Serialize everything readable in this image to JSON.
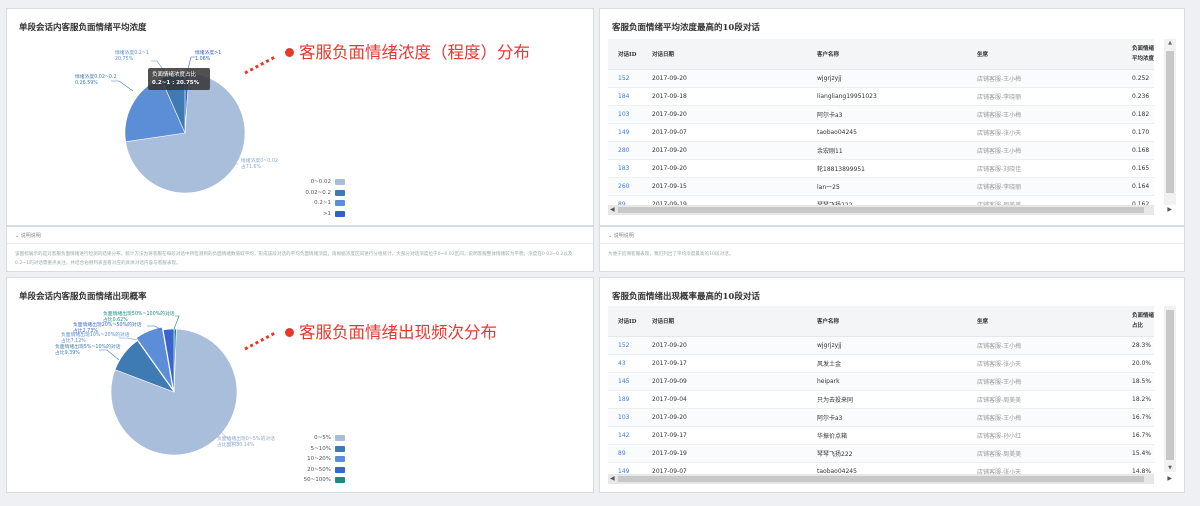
{
  "panels": {
    "pie1_title": "单段会话内客服负面情绪平均浓度",
    "pie2_title": "单段会话内客服负面情绪出现概率",
    "table1_title": "客服负面情绪平均浓度最高的10段对话",
    "table2_title": "客服负面情绪出现概率最高的10段对话"
  },
  "callouts": {
    "pie1": "客服负面情绪浓度（程度）分布",
    "pie2": "客服负面情绪出现频次分布"
  },
  "tooltip": {
    "title": "负面情绪浓度占比",
    "value": "0.2~1 : 20.75%"
  },
  "pie1_labels": {
    "a": "情绪浓度0~0.02",
    "a2": "占71.6%",
    "b": "情绪浓度0.02~0.2",
    "b2": "0.26.59%",
    "c": "情绪浓度0.2~1",
    "c2": "20.75%",
    "d": "情绪浓度>1",
    "d2": "1.06%"
  },
  "pie2_labels": {
    "a": "负面情绪出现0~5%的对话",
    "a2": "占比面积80.14%",
    "b": "负面情绪出现5%~10%的对话",
    "b2": "占比9.39%",
    "c": "负面情绪出现10%~20%的对话",
    "c2": "占比7.12%",
    "d": "负面情绪出现20%~50%的对话",
    "d2": "占比2.73%",
    "e": "负面情绪出现50%~100%的对话",
    "e2": "占比0.62%"
  },
  "chart_data": [
    {
      "type": "pie",
      "title": "单段会话内客服负面情绪平均浓度",
      "categories": [
        "0~0.02",
        "0.02~0.2",
        "0.2~1",
        ">1"
      ],
      "values": [
        71.6,
        6.59,
        20.75,
        1.06
      ],
      "colors": [
        "#a9bedb",
        "#3f7bb3",
        "#5b8ed6",
        "#2f5fd0"
      ],
      "legend": "bottom-right"
    },
    {
      "type": "pie",
      "title": "单段会话内客服负面情绪出现概率",
      "categories": [
        "0~5%",
        "5~10%",
        "10~20%",
        "20~50%",
        "50~100%"
      ],
      "values": [
        80.14,
        9.39,
        7.12,
        2.73,
        0.62
      ],
      "colors": [
        "#a9bedb",
        "#3f7bb3",
        "#5b8ed6",
        "#3c64cf",
        "#1f8a84"
      ],
      "legend": "bottom-right"
    }
  ],
  "desc1": {
    "header": "说明说明",
    "text": "该图标展示的是对客服负面情绪进行检测的结果分布。统计方法为将客服在每段对话中所检测到的负面情绪数值取平均，形成该段对话的平均负面情绪浓度，再根据浓度区间进行分组统计。大部分对话浓度位于0~0.02区间，说明客服整体情绪较为平稳；浓度在0.02~0.2以及0.2~1的对话需重点关注，并结合右侧列表查看对应的具体对话内容与客服表现。"
  },
  "desc2": {
    "header": "说明说明",
    "text": "为便于追溯客服表现，我们列出了平均浓度最高的10段对话。"
  },
  "table_headers": {
    "id": "对话ID",
    "date": "对话日期",
    "customer": "客户名称",
    "agent": "坐席",
    "t1_metric_1": "负面情绪",
    "t1_metric_2": "平均浓度",
    "t2_metric_1": "负面情绪",
    "t2_metric_2": "占比"
  },
  "table1_rows": [
    {
      "id": "152",
      "date": "2017-09-20",
      "customer": "wjgrjzyjj",
      "agent": "店铺客服-王小梅",
      "value": "0.252"
    },
    {
      "id": "184",
      "date": "2017-09-18",
      "customer": "liangliang19951023",
      "agent": "店铺客服-李晓丽",
      "value": "0.236"
    },
    {
      "id": "103",
      "date": "2017-09-20",
      "customer": "阿尔卡a3",
      "agent": "店铺客服-王小梅",
      "value": "0.182"
    },
    {
      "id": "149",
      "date": "2017-09-07",
      "customer": "taobao04245",
      "agent": "店铺客服-张小天",
      "value": "0.170"
    },
    {
      "id": "280",
      "date": "2017-09-20",
      "customer": "余宏刚11",
      "agent": "店铺客服-王小梅",
      "value": "0.168"
    },
    {
      "id": "183",
      "date": "2017-09-20",
      "customer": "轮18813899951",
      "agent": "店铺客服-刘晓佳",
      "value": "0.165"
    },
    {
      "id": "260",
      "date": "2017-09-15",
      "customer": "lan一25",
      "agent": "店铺客服-李晓丽",
      "value": "0.164"
    },
    {
      "id": "89",
      "date": "2017-09-19",
      "customer": "琴琴飞扬222",
      "agent": "店铺客服-周美美",
      "value": "0.162"
    }
  ],
  "table2_rows": [
    {
      "id": "152",
      "date": "2017-09-20",
      "customer": "wjgrjzyjj",
      "agent": "店铺客服-王小梅",
      "value": "28.3%"
    },
    {
      "id": "43",
      "date": "2017-09-17",
      "customer": "风发土金",
      "agent": "店铺客服-张小天",
      "value": "20.0%"
    },
    {
      "id": "145",
      "date": "2017-09-09",
      "customer": "heipark",
      "agent": "店铺客服-王小梅",
      "value": "18.5%"
    },
    {
      "id": "189",
      "date": "2017-09-04",
      "customer": "只为去投来同",
      "agent": "店铺客服-周美美",
      "value": "18.2%"
    },
    {
      "id": "103",
      "date": "2017-09-20",
      "customer": "阿尔卡a3",
      "agent": "店铺客服-王小梅",
      "value": "16.7%"
    },
    {
      "id": "142",
      "date": "2017-09-17",
      "customer": "华振价点箱",
      "agent": "店铺客服-孙小红",
      "value": "16.7%"
    },
    {
      "id": "89",
      "date": "2017-09-19",
      "customer": "琴琴飞扬222",
      "agent": "店铺客服-周美美",
      "value": "15.4%"
    },
    {
      "id": "149",
      "date": "2017-09-07",
      "customer": "taobao04245",
      "agent": "店铺客服-张小天",
      "value": "14.8%"
    }
  ]
}
